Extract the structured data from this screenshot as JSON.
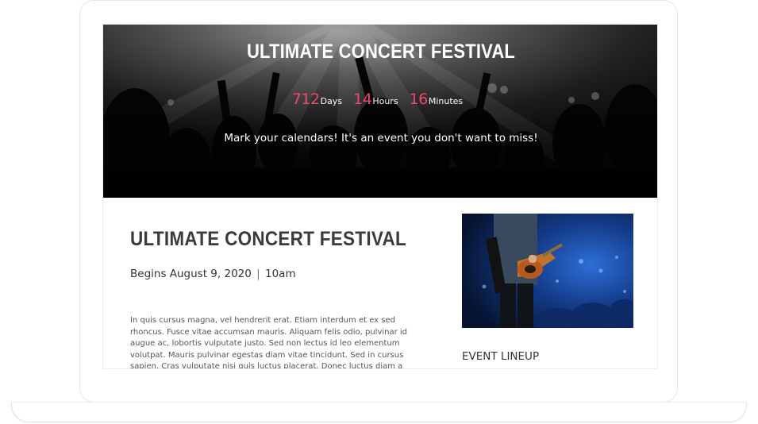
{
  "hero": {
    "title": "ULTIMATE CONCERT FESTIVAL",
    "countdown": {
      "days_value": "712",
      "days_label": "Days",
      "hours_value": "14",
      "hours_label": "Hours",
      "minutes_value": "16",
      "minutes_label": "Minutes"
    },
    "tagline": "Mark your calendars! It's an event you don't want to miss!"
  },
  "main": {
    "title": "ULTIMATE CONCERT FESTIVAL",
    "date": "Begins August 9, 2020",
    "separator": "|",
    "time": "10am",
    "description": "In quis cursus magna, vel hendrerit erat. Etiam interdum et ex sed rhoncus. Fusce vitae accumsan mauris. Aliquam felis odio, pulvinar id augue ac, lobortis vulputate justo. Sed non lectus id leo elementum volutpat. Mauris pulvinar egestas diam vitae tincidunt. Sed in cursus sapien. Cras vulputate nisi quis luctus placerat. Donec luctus diam a quam ultrices auctor. Phasellus eu neque ac lacus aliquet ornare. Donec placerat dui at pretium commodo. Curabitur accumsan euismod purus, ac pellentesque tellus mattis sit amet."
  },
  "sidebar": {
    "photo_icon": "concert-guitarist-photo",
    "lineup_heading": "EVENT LINEUP"
  },
  "colors": {
    "accent": "#f0476b",
    "hero_bg": "#0b0b0b",
    "heading_text": "#3b3b3b",
    "body_text": "#555555"
  }
}
